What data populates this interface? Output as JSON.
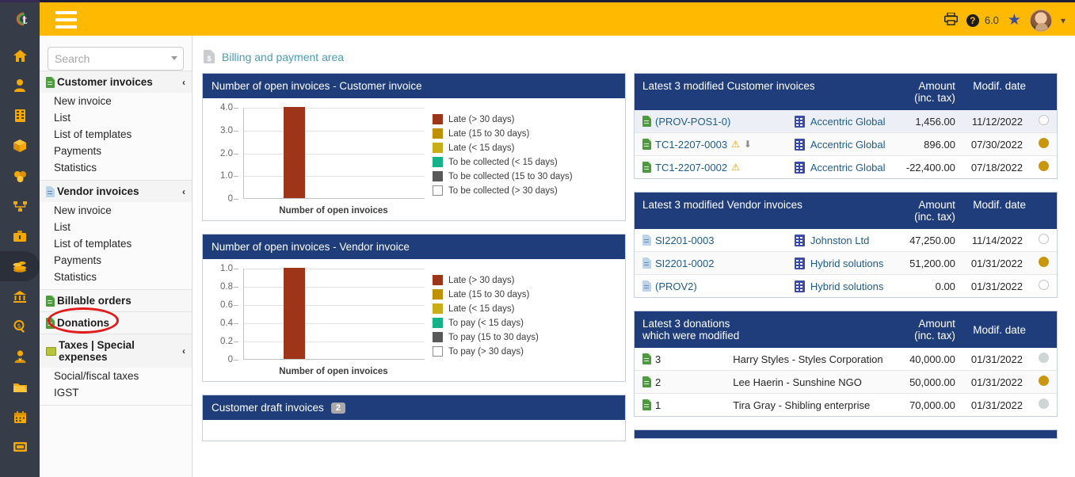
{
  "app": {
    "version_label": "6.0",
    "hamburger": "menu-toggle"
  },
  "rail": {
    "items": [
      {
        "name": "home-icon",
        "label": "Home"
      },
      {
        "name": "user-icon",
        "label": "Members"
      },
      {
        "name": "building-icon",
        "label": "Third parties"
      },
      {
        "name": "box-icon",
        "label": "Products"
      },
      {
        "name": "stock-icon",
        "label": "Commercial"
      },
      {
        "name": "network-icon",
        "label": "Projects"
      },
      {
        "name": "briefcase-icon",
        "label": "HRM"
      },
      {
        "name": "coins-icon",
        "label": "Billing and payment"
      },
      {
        "name": "bank-icon",
        "label": "Bank"
      },
      {
        "name": "accounting-search-icon",
        "label": "Accounting"
      },
      {
        "name": "employee-icon",
        "label": "Employees"
      },
      {
        "name": "folder-icon",
        "label": "Documents"
      },
      {
        "name": "calendar-icon",
        "label": "Agenda"
      },
      {
        "name": "ticket-icon",
        "label": "Tickets"
      }
    ],
    "active_index": 7
  },
  "search": {
    "placeholder": "Search",
    "value": ""
  },
  "sidebar": {
    "blocks": [
      {
        "title": "Customer invoices",
        "icon": "doc-green-icon",
        "chevron": "‹",
        "items": [
          "New invoice",
          "List",
          "List of templates",
          "Payments",
          "Statistics"
        ]
      },
      {
        "title": "Vendor invoices",
        "icon": "doc-blue-icon",
        "chevron": "‹",
        "items": [
          "New invoice",
          "List",
          "List of templates",
          "Payments",
          "Statistics"
        ]
      },
      {
        "title": "Billable orders",
        "icon": "doc-green-icon",
        "chevron": "",
        "items": []
      },
      {
        "title": "Donations",
        "icon": "doc-green-icon",
        "chevron": "",
        "items": []
      },
      {
        "title": "Taxes | Special expenses",
        "icon": "tax-icon",
        "chevron": "‹",
        "items": [
          "Social/fiscal taxes",
          "IGST"
        ]
      }
    ],
    "highlighted_item": "Payments"
  },
  "breadcrumb": {
    "icon": "billing-doc-icon",
    "text": "Billing and payment area"
  },
  "chart_data": [
    {
      "type": "bar",
      "title": "Number of open invoices - Customer invoice",
      "categories": [
        "Number of open invoices"
      ],
      "values": [
        4
      ],
      "xlabel": "Number of open invoices",
      "ylabel": "",
      "ylim": [
        0,
        4
      ],
      "yticks": [
        "4.0",
        "3.0",
        "2.0",
        "1.0",
        "0"
      ],
      "grid": true,
      "legend_position": "right",
      "series": [
        {
          "name": "Late (> 30 days)",
          "color": "#9e3418",
          "value": 4
        },
        {
          "name": "Late (15 to 30 days)",
          "color": "#bf9000",
          "value": 0
        },
        {
          "name": "Late (< 15 days)",
          "color": "#c9ad17",
          "value": 0
        },
        {
          "name": "To be collected (< 15 days)",
          "color": "#13b387",
          "value": 0
        },
        {
          "name": "To be collected (15 to 30 days)",
          "color": "#595959",
          "value": 0
        },
        {
          "name": "To be collected (> 30 days)",
          "color": "#ffffff",
          "value": 0
        }
      ]
    },
    {
      "type": "bar",
      "title": "Number of open invoices - Vendor invoice",
      "categories": [
        "Number of open invoices"
      ],
      "values": [
        1
      ],
      "xlabel": "Number of open invoices",
      "ylabel": "",
      "ylim": [
        0,
        1
      ],
      "yticks": [
        "1.0",
        "0.8",
        "0.6",
        "0.4",
        "0.2",
        "0"
      ],
      "grid": true,
      "legend_position": "right",
      "series": [
        {
          "name": "Late (> 30 days)",
          "color": "#9e3418",
          "value": 1
        },
        {
          "name": "Late (15 to 30 days)",
          "color": "#bf9000",
          "value": 0
        },
        {
          "name": "Late (< 15 days)",
          "color": "#c9ad17",
          "value": 0
        },
        {
          "name": "To pay (< 15 days)",
          "color": "#13b387",
          "value": 0
        },
        {
          "name": "To pay (15 to 30 days)",
          "color": "#595959",
          "value": 0
        },
        {
          "name": "To pay (> 30 days)",
          "color": "#ffffff",
          "value": 0
        }
      ]
    }
  ],
  "draft_card": {
    "title": "Customer draft invoices",
    "count": "2"
  },
  "customer_invoices": {
    "title": "Latest 3 modified Customer invoices",
    "col_amount": "Amount (inc. tax)",
    "col_date": "Modif. date",
    "rows": [
      {
        "ref": "(PROV-POS1-0)",
        "icon": "doc-green-icon",
        "warn": false,
        "download": false,
        "company": "Accentric Global",
        "amount": "1,456.00",
        "date": "11/12/2022",
        "status": "open"
      },
      {
        "ref": "TC1-2207-0003",
        "icon": "doc-green-icon",
        "warn": true,
        "download": true,
        "company": "Accentric Global",
        "amount": "896.00",
        "date": "07/30/2022",
        "status": "gold"
      },
      {
        "ref": "TC1-2207-0002",
        "icon": "doc-green-icon",
        "warn": true,
        "download": false,
        "company": "Accentric Global",
        "amount": "-22,400.00",
        "date": "07/18/2022",
        "status": "gold"
      }
    ]
  },
  "vendor_invoices": {
    "title": "Latest 3 modified Vendor invoices",
    "col_amount": "Amount (inc. tax)",
    "col_date": "Modif. date",
    "rows": [
      {
        "ref": "SI2201-0003",
        "icon": "doc-blue-icon",
        "company": "Johnston Ltd",
        "amount": "47,250.00",
        "date": "11/14/2022",
        "status": "open"
      },
      {
        "ref": "SI2201-0002",
        "icon": "doc-blue-icon",
        "company": "Hybrid solutions",
        "amount": "51,200.00",
        "date": "01/31/2022",
        "status": "gold"
      },
      {
        "ref": "(PROV2)",
        "icon": "doc-blue-icon",
        "company": "Hybrid solutions",
        "amount": "0.00",
        "date": "01/31/2022",
        "status": "open"
      }
    ]
  },
  "donations": {
    "title_line1": "Latest 3 donations",
    "title_line2": "which were modified",
    "col_amount": "Amount (inc. tax)",
    "col_date": "Modif. date",
    "rows": [
      {
        "ref": "3",
        "icon": "doc-green-icon",
        "donor": "Harry Styles - Styles Corporation",
        "amount": "40,000.00",
        "date": "01/31/2022",
        "status": "grey"
      },
      {
        "ref": "2",
        "icon": "doc-green-icon",
        "donor": "Lee Haerin - Sunshine NGO",
        "amount": "50,000.00",
        "date": "01/31/2022",
        "status": "gold"
      },
      {
        "ref": "1",
        "icon": "doc-green-icon",
        "donor": "Tira Gray - Shibling enterprise",
        "amount": "70,000.00",
        "date": "01/31/2022",
        "status": "grey"
      }
    ]
  },
  "colors": {
    "brand_yellow": "#ffb900",
    "panel_blue": "#1f3d7a",
    "rail_dark": "#373d48",
    "link_blue": "#1f5c8b",
    "bar_red": "#9e3418",
    "annotation_red": "#e01b1b"
  }
}
